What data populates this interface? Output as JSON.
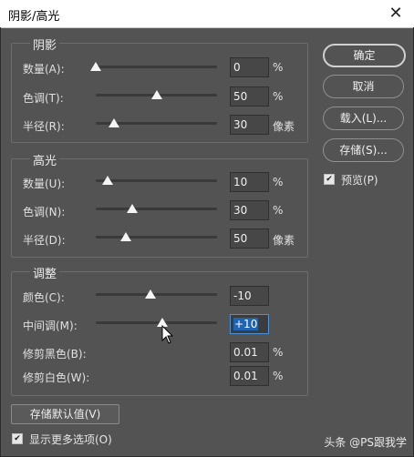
{
  "window": {
    "title": "阴影/高光",
    "close_symbol": "✕"
  },
  "groups": {
    "shadow": {
      "title": "阴影",
      "rows": [
        {
          "label": "数量(A):",
          "value": "0",
          "unit": "%",
          "slider_fraction": 0.0
        },
        {
          "label": "色调(T):",
          "value": "50",
          "unit": "%",
          "slider_fraction": 0.5
        },
        {
          "label": "半径(R):",
          "value": "30",
          "unit": "像素",
          "slider_fraction": 0.15
        }
      ]
    },
    "highlight": {
      "title": "高光",
      "rows": [
        {
          "label": "数量(U):",
          "value": "10",
          "unit": "%",
          "slider_fraction": 0.1
        },
        {
          "label": "色调(N):",
          "value": "30",
          "unit": "%",
          "slider_fraction": 0.3
        },
        {
          "label": "半径(D):",
          "value": "50",
          "unit": "像素",
          "slider_fraction": 0.25
        }
      ]
    },
    "adjust": {
      "title": "调整",
      "rows": [
        {
          "label": "颜色(C):",
          "value": "-10",
          "unit": "",
          "slider_fraction": 0.45
        },
        {
          "label": "中间调(M):",
          "value": "+10",
          "unit": "",
          "slider_fraction": 0.55,
          "active": true
        },
        {
          "label": "修剪黑色(B):",
          "value": "0.01",
          "unit": "%"
        },
        {
          "label": "修剪白色(W):",
          "value": "0.01",
          "unit": "%"
        }
      ]
    }
  },
  "buttons": {
    "ok": "确定",
    "cancel": "取消",
    "load": "载入(L)...",
    "save": "存储(S)..."
  },
  "preview": {
    "label": "预览(P)",
    "checked": true
  },
  "save_default": "存储默认值(V)",
  "more_options": {
    "label": "显示更多选项(O)",
    "checked": true
  },
  "watermark": "头条 @PS跟我学",
  "check_symbol": "✔"
}
